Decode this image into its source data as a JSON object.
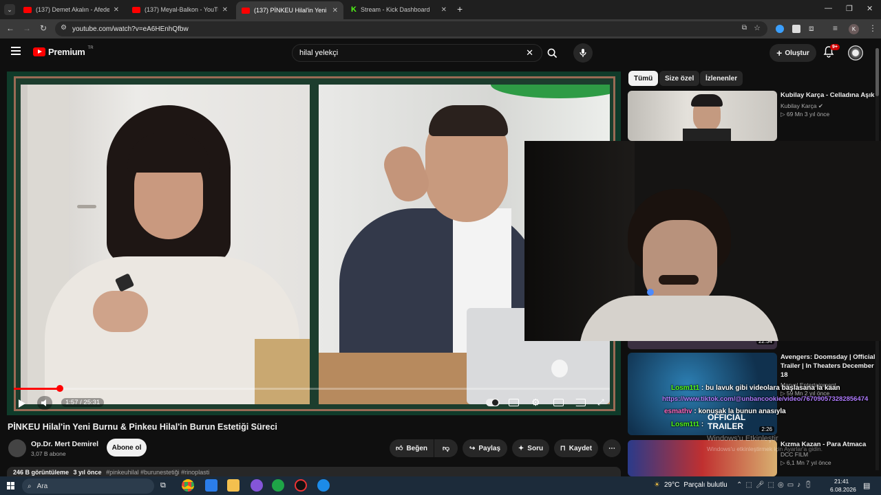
{
  "browser": {
    "tabs": [
      {
        "title": "(137) Demet Akalın - Afede",
        "icon": "youtube-icon"
      },
      {
        "title": "(137) Meyal-Balkon - YouTube",
        "icon": "youtube-icon"
      },
      {
        "title": "(137) PİNKEU Hilal'in Yeni Burnu",
        "icon": "youtube-icon",
        "active": true
      },
      {
        "title": "Stream - Kick Dashboard",
        "icon": "kick-icon"
      }
    ],
    "url": "youtube.com/watch?v=eA6HEnhQfbw",
    "profile_initial": "K"
  },
  "youtube": {
    "logo_text": "Premium",
    "logo_region": "TR",
    "search_value": "hilal yelekçi",
    "create_label": "Oluştur",
    "notif_badge": "9+"
  },
  "player": {
    "time": "1:57 / 25:31",
    "progress_fraction": 0.077
  },
  "video": {
    "title": "PİNKEU Hilal'in Yeni Burnu & Pinkeu Hilal'in Burun Estetiği Süreci",
    "channel": "Op.Dr. Mert Demirel",
    "subscribers": "3,07 B abone",
    "subscribe_label": "Abone ol",
    "like_label": "Beğen",
    "share_label": "Paylaş",
    "ask_label": "Soru",
    "save_label": "Kaydet",
    "views": "246 B görüntüleme",
    "age": "3 yıl önce",
    "hashtags": "#pinkeuhilal #burunestetiği #rinoplasti"
  },
  "sidebar": {
    "chips": [
      "Tümü",
      "Size özel",
      "İzlenenler"
    ],
    "recs": [
      {
        "title": "Kubilay Karça - Celladına Aşık",
        "channel": "Kubilay Karça",
        "meta": "69 Mn  3 yıl önce"
      },
      {
        "title": "Avengers: Doomsday | Official Trailer | In Theaters December 18",
        "channel": "Marvel Entertainment",
        "meta": "59 Mn  2 yıl önce",
        "duration": "2:26"
      },
      {
        "title": "Kızma Kazan - Para Atmaca",
        "channel": "DCC FILM",
        "meta": "6,1 Mn  7 yıl önce"
      }
    ],
    "partial_duration": "22:34"
  },
  "overlay": {
    "chat": [
      {
        "user": "Losm1t1",
        "text": " : bu lavuk gibi videolara başlasana la kaan"
      },
      {
        "user": "",
        "text": "https://www.tiktok.com/@unbancookie/video/7670905732828564​74"
      },
      {
        "user": "esmathv",
        "text": " : konuşak la bunun anasıyla"
      },
      {
        "user": "Losm1t1",
        "text": " : "
      }
    ],
    "thumb_text": "OFFICIAL TRAILER",
    "watermark1": "Windows'u Etkinleştir",
    "watermark2": "Windows'u etkinleştirmek için Ayarlar'a gidin."
  },
  "taskbar": {
    "search_placeholder": "Ara",
    "weather_temp": "29°C",
    "weather_text": "Parçalı bulutlu",
    "time": "21:41",
    "date": "6.08.2026"
  },
  "colors": {
    "accent": "#ff0000",
    "kick": "#53fc18",
    "chat_user": "#53fc18",
    "link": "#b07cff"
  }
}
